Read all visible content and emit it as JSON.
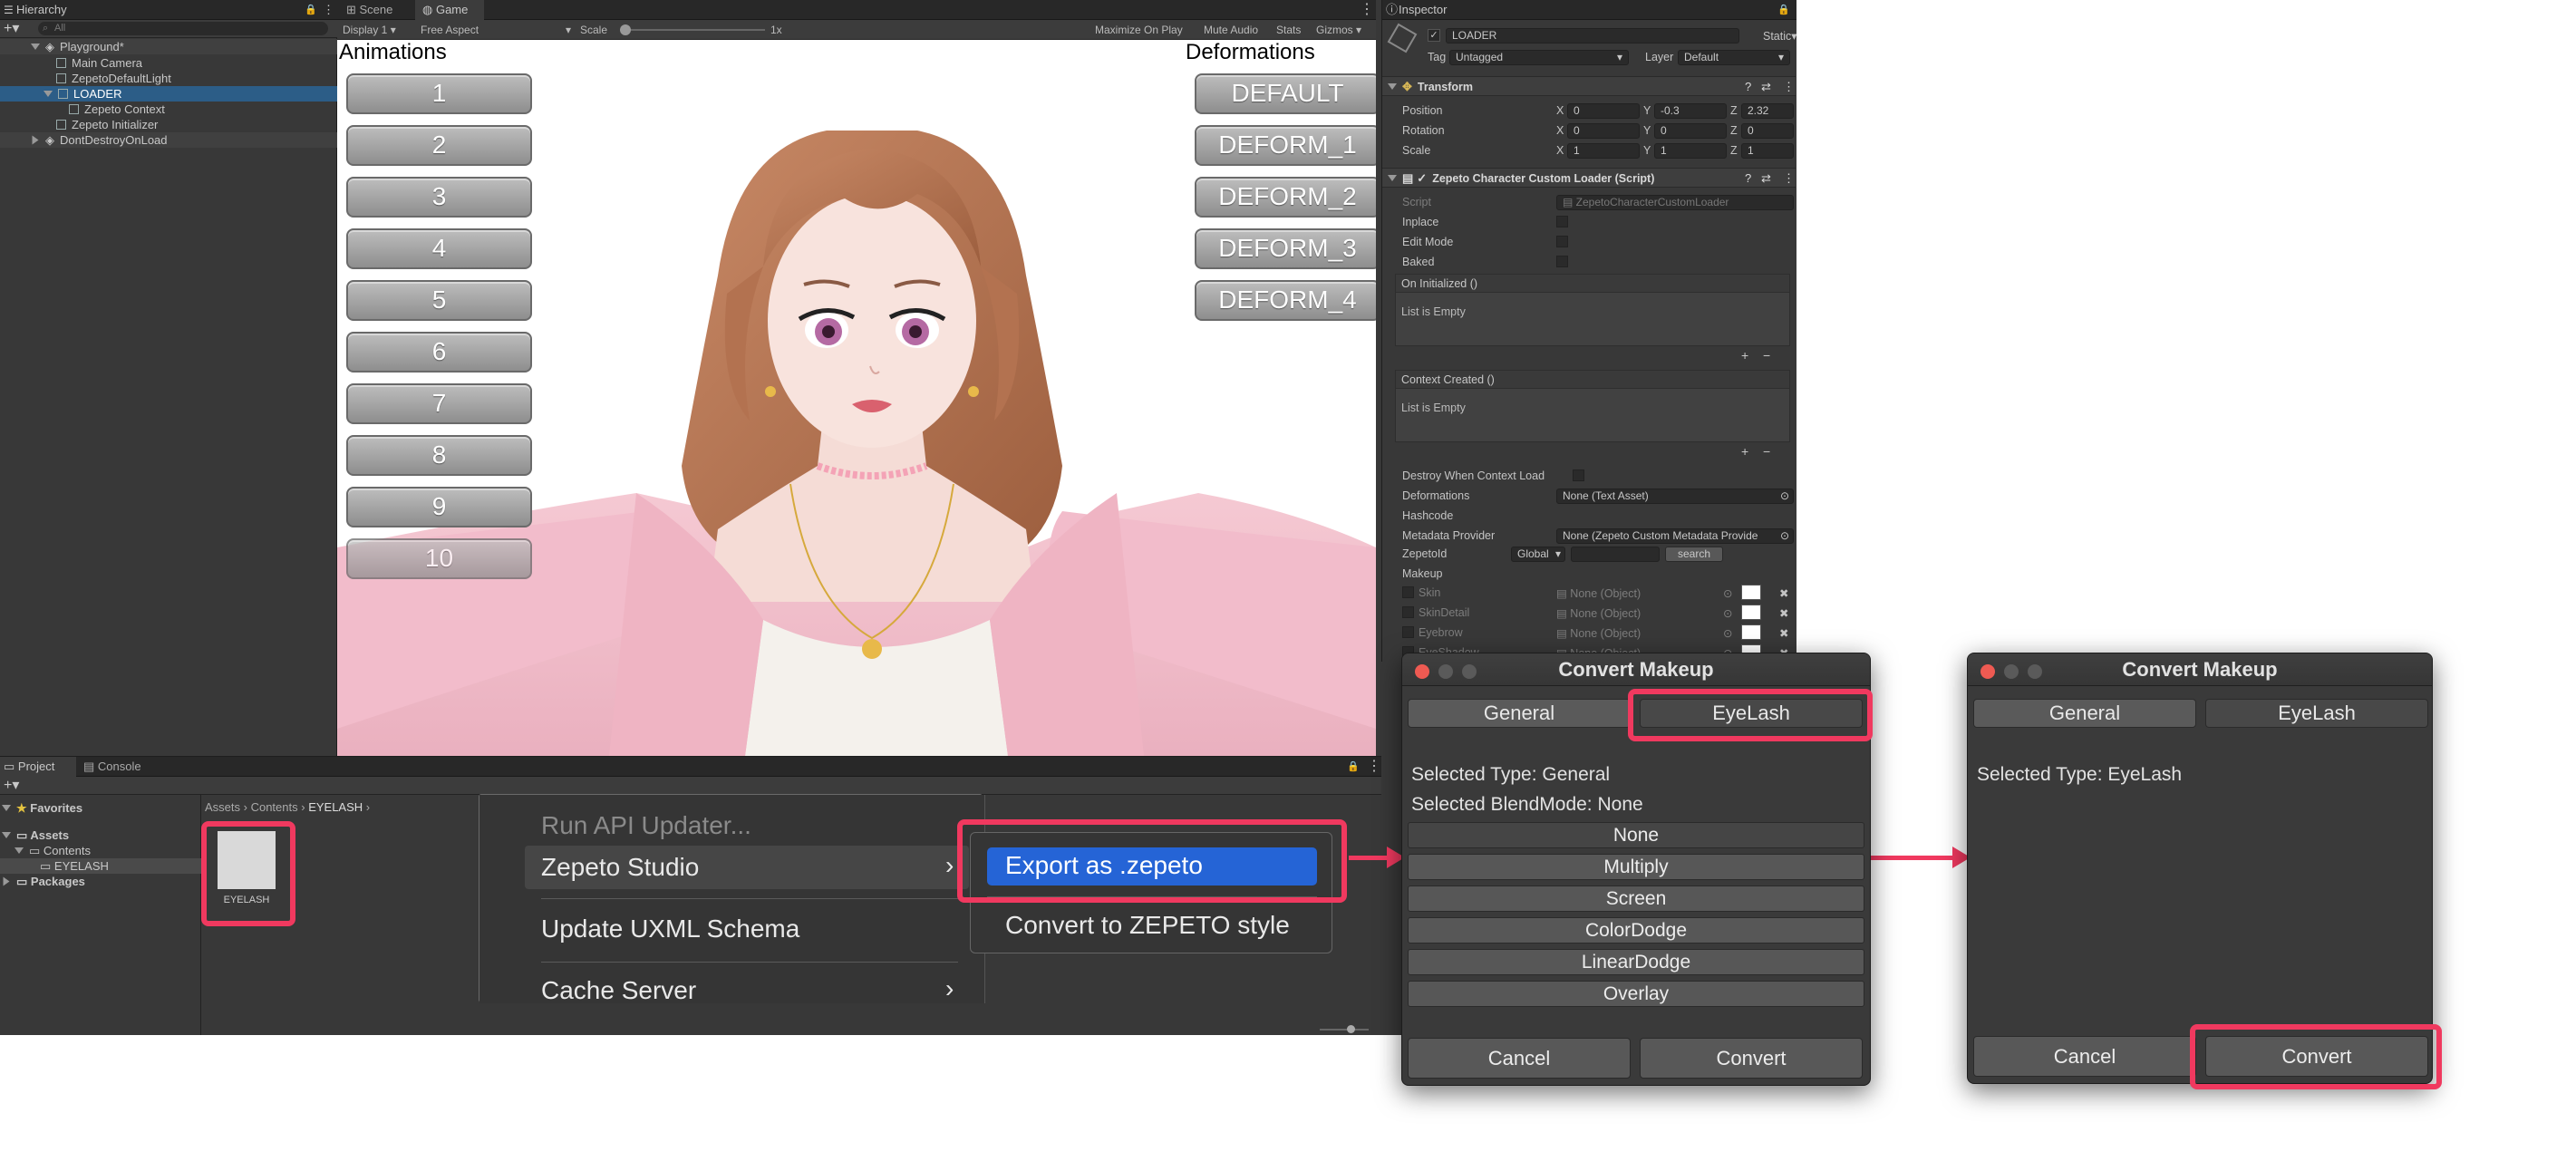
{
  "hierarchy": {
    "tab": "Hierarchy",
    "search_placeholder": "All",
    "rows": [
      "Playground*",
      "Main Camera",
      "ZepetoDefaultLight",
      "LOADER",
      "Zepeto Context",
      "Zepeto Initializer",
      "DontDestroyOnLoad"
    ]
  },
  "scene_tabs": {
    "scene": "Scene",
    "game": "Game"
  },
  "game_toolbar": {
    "display": "Display 1",
    "aspect": "Free Aspect",
    "scale_label": "Scale",
    "scale_value": "1x",
    "maximize": "Maximize On Play",
    "mute": "Mute Audio",
    "stats": "Stats",
    "gizmos": "Gizmos"
  },
  "game": {
    "animations_label": "Animations",
    "deformations_label": "Deformations",
    "animation_buttons": [
      "1",
      "2",
      "3",
      "4",
      "5",
      "6",
      "7",
      "8",
      "9",
      "10"
    ],
    "deform_buttons": [
      "DEFAULT",
      "DEFORM_1",
      "DEFORM_2",
      "DEFORM_3",
      "DEFORM_4"
    ]
  },
  "inspector": {
    "tab": "Inspector",
    "object_name": "LOADER",
    "static": "Static",
    "tag_label": "Tag",
    "tag_value": "Untagged",
    "layer_label": "Layer",
    "layer_value": "Default",
    "transform_title": "Transform",
    "position": {
      "label": "Position",
      "x": "0",
      "y": "-0.3",
      "z": "2.32"
    },
    "rotation": {
      "label": "Rotation",
      "x": "0",
      "y": "0",
      "z": "0"
    },
    "scale": {
      "label": "Scale",
      "x": "1",
      "y": "1",
      "z": "1"
    },
    "script_title": "Zepeto Character Custom Loader (Script)",
    "script_label": "Script",
    "script_value": "ZepetoCharacterCustomLoader",
    "inplace": "Inplace",
    "edit_mode": "Edit Mode",
    "baked": "Baked",
    "on_initialized": "On Initialized ()",
    "list_empty": "List is Empty",
    "context_created": "Context Created ()",
    "destroy_when": "Destroy When Context Load",
    "deformations_label": "Deformations",
    "deformations_value": "None (Text Asset)",
    "hashcode": "Hashcode",
    "metadata_label": "Metadata Provider",
    "metadata_value": "None (Zepeto Custom Metadata Provide",
    "zepetoid_label": "ZepetoId",
    "zepetoid_value": "Global",
    "search_btn": "search",
    "makeup": "Makeup",
    "makeup_rows": [
      {
        "label": "Skin",
        "value": "None (Object)"
      },
      {
        "label": "SkinDetail",
        "value": "None (Object)"
      },
      {
        "label": "Eyebrow",
        "value": "None (Object)"
      },
      {
        "label": "EyeShadow",
        "value": "None (Object)"
      }
    ]
  },
  "project": {
    "tab": "Project",
    "console_tab": "Console",
    "favorites": "Favorites",
    "assets": "Assets",
    "contents": "Contents",
    "eyelash": "EYELASH",
    "packages": "Packages",
    "breadcrumb": [
      "Assets",
      "Contents",
      "EYELASH"
    ],
    "asset_label": "EYELASH"
  },
  "context_menu": {
    "items": [
      "Run API Updater...",
      "Zepeto Studio",
      "Update UXML Schema",
      "Cache Server"
    ],
    "submenu": [
      "Export as .zepeto",
      "Convert to ZEPETO style"
    ]
  },
  "dialog1": {
    "title": "Convert Makeup",
    "tabs": [
      "General",
      "EyeLash"
    ],
    "selected_type": "Selected Type: General",
    "selected_blend": "Selected BlendMode: None",
    "blend_modes": [
      "None",
      "Multiply",
      "Screen",
      "ColorDodge",
      "LinearDodge",
      "Overlay"
    ],
    "cancel": "Cancel",
    "convert": "Convert"
  },
  "dialog2": {
    "title": "Convert Makeup",
    "tabs": [
      "General",
      "EyeLash"
    ],
    "selected_type": "Selected Type: EyeLash",
    "cancel": "Cancel",
    "convert": "Convert"
  },
  "colors": {
    "highlight": "#f0395f",
    "selection": "#2c5d87",
    "menu_selected": "#2564d6"
  }
}
